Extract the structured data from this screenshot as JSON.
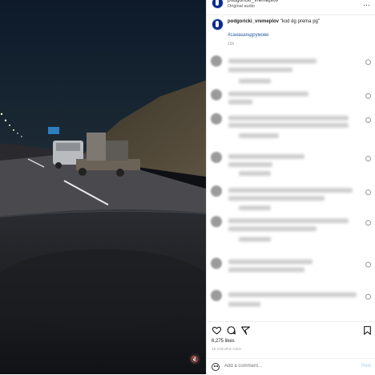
{
  "header": {
    "username": "podgoricki_vremeplov",
    "audio": "Original audio"
  },
  "caption": {
    "username": "podgoricki_vremeplov",
    "text": "\"kod dg prema pg\"",
    "hashtag": "#санашиндрумове",
    "time": "15h"
  },
  "comment_count": 8,
  "likes": "6,275 likes",
  "posted": "15 HOURS AGO",
  "add_comment": {
    "placeholder": "Add a comment...",
    "post_label": "Post"
  },
  "colors": {
    "accent_link": "#2f5fa8",
    "avatar_blue": "#0b2a8c",
    "post_disabled": "#a5c8f2"
  },
  "icons": [
    "heart-icon",
    "comment-icon",
    "share-icon",
    "bookmark-icon",
    "emoji-icon",
    "more-icon",
    "mute-icon"
  ]
}
